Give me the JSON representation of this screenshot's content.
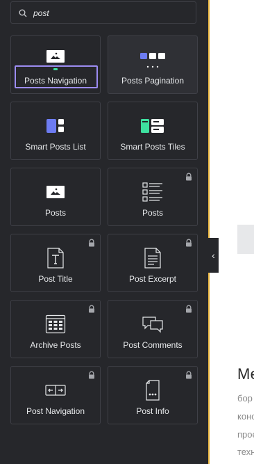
{
  "search": {
    "value": "post",
    "icon": "search-icon"
  },
  "widgets": [
    {
      "label": "Posts Navigation",
      "icon": "image-dots-icon",
      "locked": false,
      "focused": true
    },
    {
      "label": "Posts Pagination",
      "icon": "pagination-icon",
      "locked": false,
      "highlighted": true
    },
    {
      "label": "Smart Posts List",
      "icon": "smart-list-icon",
      "locked": false
    },
    {
      "label": "Smart Posts Tiles",
      "icon": "smart-tiles-icon",
      "locked": false
    },
    {
      "label": "Posts",
      "icon": "image-posts-icon",
      "locked": false
    },
    {
      "label": "Posts",
      "icon": "posts-grid-icon",
      "locked": true
    },
    {
      "label": "Post Title",
      "icon": "post-title-icon",
      "locked": true
    },
    {
      "label": "Post Excerpt",
      "icon": "post-excerpt-icon",
      "locked": true
    },
    {
      "label": "Archive Posts",
      "icon": "archive-posts-icon",
      "locked": true
    },
    {
      "label": "Post Comments",
      "icon": "post-comments-icon",
      "locked": true
    },
    {
      "label": "Post Navigation",
      "icon": "post-navigation-icon",
      "locked": true
    },
    {
      "label": "Post Info",
      "icon": "post-info-icon",
      "locked": true
    }
  ],
  "collapse_button": {
    "glyph": "‹"
  },
  "canvas": {
    "heading": "Ме",
    "lines": [
      "бор",
      "конс",
      "проє",
      "техн"
    ]
  },
  "colors": {
    "panel_bg": "#26272b",
    "tile_border": "#3f4047",
    "accent_purple": "#9c8cf2",
    "accent_teal": "#3ee0a0",
    "icon_blue": "#6d7cf2",
    "edge_yellow": "#e5b23d"
  }
}
